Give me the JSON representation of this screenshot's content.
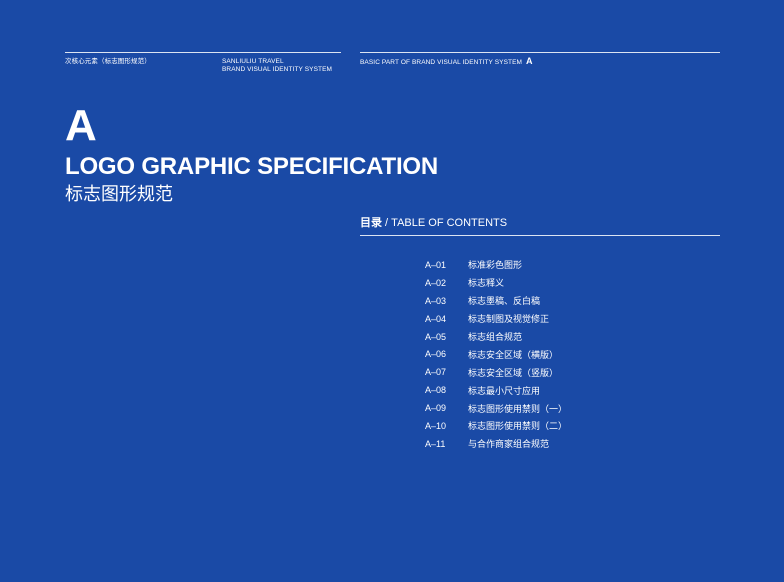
{
  "header": {
    "left_text": "次核心元素（标志图形规范）",
    "middle_line1": "SANLIULIU TRAVEL",
    "middle_line2": "BRAND VISUAL IDENTITY SYSTEM",
    "right_text": "BASIC PART OF BRAND VISUAL IDENTITY SYSTEM",
    "right_letter": "A"
  },
  "section": {
    "letter": "A",
    "title_en": "LOGO GRAPHIC SPECIFICATION",
    "title_cn": "标志图形规范"
  },
  "toc": {
    "title_cn": "目录",
    "title_sep": " / ",
    "title_en": "TABLE OF CONTENTS",
    "items": [
      {
        "code": "A–01",
        "label": "标准彩色图形"
      },
      {
        "code": "A–02",
        "label": "标志释义"
      },
      {
        "code": "A–03",
        "label": "标志墨稿、反白稿"
      },
      {
        "code": "A–04",
        "label": "标志制图及视觉修正"
      },
      {
        "code": "A–05",
        "label": "标志组合规范"
      },
      {
        "code": "A–06",
        "label": "标志安全区域（横版）"
      },
      {
        "code": "A–07",
        "label": "标志安全区域（竖版）"
      },
      {
        "code": "A–08",
        "label": "标志最小尺寸应用"
      },
      {
        "code": "A–09",
        "label": "标志图形使用禁则（一）"
      },
      {
        "code": "A–10",
        "label": "标志图形使用禁则（二）"
      },
      {
        "code": "A–11",
        "label": "与合作商家组合规范"
      }
    ]
  },
  "colors": {
    "background": "#1a4aa6",
    "text": "#ffffff"
  }
}
